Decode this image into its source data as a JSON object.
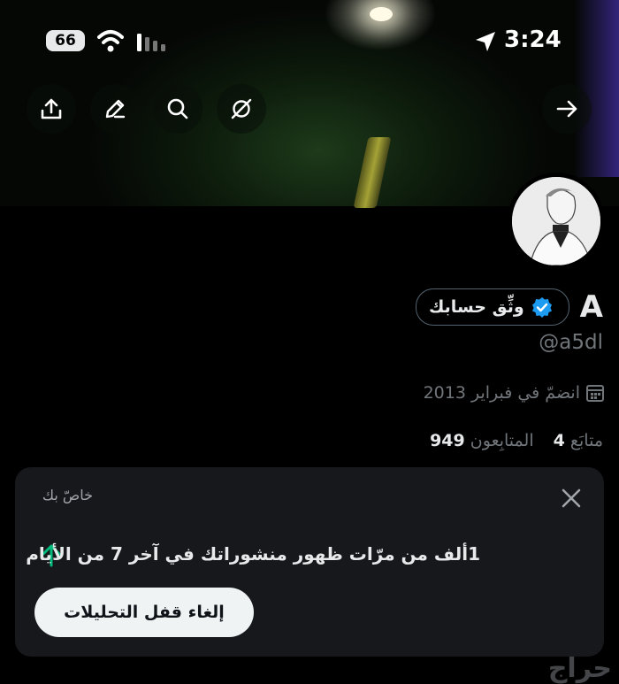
{
  "status_bar": {
    "battery": "66",
    "time": "3:24"
  },
  "profile": {
    "name": "A",
    "verify_label": "وثِّق حسابك",
    "handle": "@a5dl",
    "joined": "انضمّ في فبراير 2013",
    "following_count": "4",
    "following_label": "متابَع",
    "followers_count": "949",
    "followers_label": "المتابِعون"
  },
  "analytics_card": {
    "label": "خاصّ بك",
    "message": "1ألف من مرّات ظهور منشوراتك في آخر 7 من الأيام",
    "button_label": "إلغاء قفل التحليلات"
  },
  "watermark": "حراج",
  "icons": [
    "share-icon",
    "edit-icon",
    "search-icon",
    "grok-icon",
    "back-arrow-icon",
    "verified-badge-icon",
    "calendar-icon",
    "close-icon",
    "trend-up-icon"
  ],
  "colors": {
    "verified_blue": "#1d9bf0",
    "trend_green": "#00ba7c",
    "muted": "#71767b"
  }
}
